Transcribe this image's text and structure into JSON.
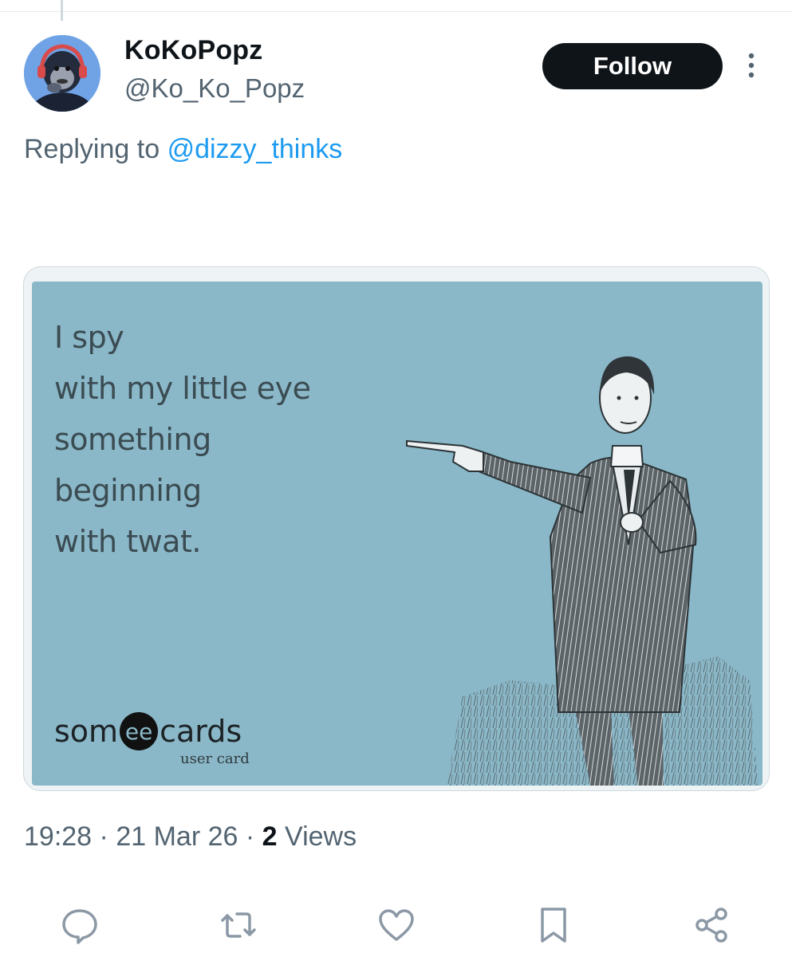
{
  "tweet": {
    "display_name": "KoKoPopz",
    "handle": "@Ko_Ko_Popz",
    "follow_label": "Follow",
    "replying_prefix": "Replying to",
    "replying_to": "@dizzy_thinks",
    "time": "19:28",
    "separator": "·",
    "date": "21 Mar 26",
    "views_count": "2",
    "views_label": "Views"
  },
  "media": {
    "lines": [
      "I spy",
      "with my little eye",
      "something",
      "beginning",
      "with twat."
    ],
    "brand_left": "som",
    "brand_mid": "ee",
    "brand_right": "cards",
    "brand_sub": "user card"
  },
  "icons": {
    "more": "more-vertical-icon",
    "reply": "reply-icon",
    "retweet": "retweet-icon",
    "like": "heart-icon",
    "bookmark": "bookmark-icon",
    "share": "share-icon"
  },
  "colors": {
    "accent": "#1d9bf0",
    "secondary_text": "#536471",
    "follow_bg": "#0f1419",
    "card_bg": "#8ab8c8"
  }
}
